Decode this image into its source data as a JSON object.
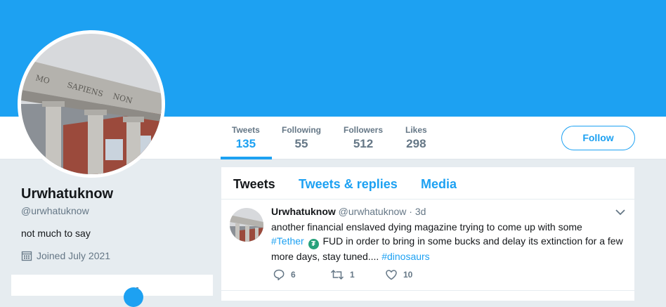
{
  "profile": {
    "name": "Urwhatuknow",
    "handle": "@urwhatuknow",
    "bio": "not much to say",
    "joined": "Joined July 2021"
  },
  "stats": [
    {
      "label": "Tweets",
      "value": "135"
    },
    {
      "label": "Following",
      "value": "55"
    },
    {
      "label": "Followers",
      "value": "512"
    },
    {
      "label": "Likes",
      "value": "298"
    }
  ],
  "follow_label": "Follow",
  "tabs": [
    {
      "label": "Tweets"
    },
    {
      "label": "Tweets & replies"
    },
    {
      "label": "Media"
    }
  ],
  "tweet": {
    "name": "Urwhatuknow",
    "handle": "@urwhatuknow",
    "dot": "·",
    "time": "3d",
    "text_1": "another financial enslaved dying magazine trying to come up with some",
    "hashtag_1": "#Tether",
    "coin_symbol": "₮",
    "text_2": " FUD in order to bring in some bucks and delay its extinction for a few more days, stay tuned.... ",
    "hashtag_2": "#dinosaurs",
    "replies": "6",
    "retweets": "1",
    "likes": "10"
  },
  "colors": {
    "accent": "#1da1f2",
    "banner": "#1da1f2",
    "tether": "#26a17b"
  },
  "icons": [
    "calendar-icon",
    "reply-icon",
    "retweet-icon",
    "like-icon",
    "caret-down-icon"
  ]
}
